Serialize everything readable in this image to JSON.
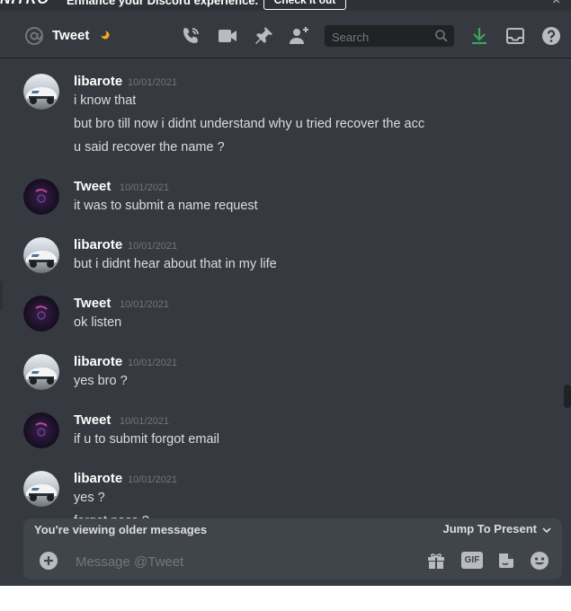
{
  "banner": {
    "logo": "NITRO",
    "message": "Enhance your Discord experience.",
    "cta": "Check it out",
    "close": "×"
  },
  "header": {
    "channel_name": "Tweet",
    "search_placeholder": "Search"
  },
  "messages": [
    {
      "author": "libarote",
      "timestamp": "10/01/2021",
      "lines": [
        "i know that",
        "but bro till now i didnt understand why u tried recover the acc",
        "u said recover the name ?"
      ]
    },
    {
      "author": "Tweet",
      "timestamp": "10/01/2021",
      "lines": [
        "it was to submit a name request"
      ]
    },
    {
      "author": "libarote",
      "timestamp": "10/01/2021",
      "lines": [
        "but i didnt hear about that in my life"
      ]
    },
    {
      "author": "Tweet",
      "timestamp": "10/01/2021",
      "lines": [
        "ok listen"
      ]
    },
    {
      "author": "libarote",
      "timestamp": "10/01/2021",
      "lines": [
        "yes bro ?"
      ]
    },
    {
      "author": "Tweet",
      "timestamp": "10/01/2021",
      "lines": [
        "if u to submit forgot email"
      ]
    },
    {
      "author": "libarote",
      "timestamp": "10/01/2021",
      "lines": [
        "yes ?",
        "forgot pass ?"
      ]
    }
  ],
  "older_bar": {
    "text": "You're viewing older messages",
    "jump": "Jump To Present"
  },
  "composer": {
    "placeholder": "Message @Tweet",
    "gif": "GIF"
  },
  "colors": {
    "background": "#36393f",
    "input": "#40444b",
    "download_accent": "#3ba55c",
    "status_idle": "#faa81a"
  }
}
